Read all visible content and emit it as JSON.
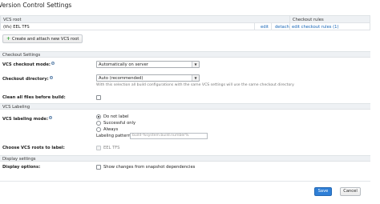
{
  "page": {
    "title": "Version Control Settings"
  },
  "vcs_table": {
    "header": {
      "root": "VCS root",
      "rules": "Checkout rules"
    },
    "rows": [
      {
        "root": "(tfs) EEL TFS",
        "edit": "edit",
        "detach": "detach",
        "rules": "edit checkout rules (1)"
      }
    ]
  },
  "add_button": {
    "label": "Create and attach new VCS root",
    "icon": "plus-icon"
  },
  "checkout_settings": {
    "title": "Checkout Settings",
    "vcs_checkout_mode": {
      "label": "VCS checkout mode:",
      "value": "Automatically on server"
    },
    "checkout_directory": {
      "label": "Checkout directory:",
      "value": "Auto (recommended)",
      "note": "With this selection all build configurations with the same VCS settings will use the same checkout directory"
    },
    "clean_all": {
      "label": "Clean all files before build:",
      "checked": false
    }
  },
  "vcs_labeling": {
    "title": "VCS Labeling",
    "mode_label": "VCS labeling mode:",
    "options": [
      "Do not label",
      "Successful only",
      "Always"
    ],
    "selected": 0,
    "pattern_label": "Labeling pattern:",
    "pattern_value": "build-%system.build.number%",
    "roots_label": "Choose VCS roots to label:",
    "roots_option": "EEL TFS"
  },
  "display_settings": {
    "title": "Display settings",
    "options_label": "Display options:",
    "show_changes": "Show changes from snapshot dependencies"
  },
  "footer": {
    "save": "Save",
    "cancel": "Cancel"
  },
  "colors": {
    "accent": "#2f7fd6",
    "link": "#1565b7",
    "section_bg": "#eef1f4"
  }
}
